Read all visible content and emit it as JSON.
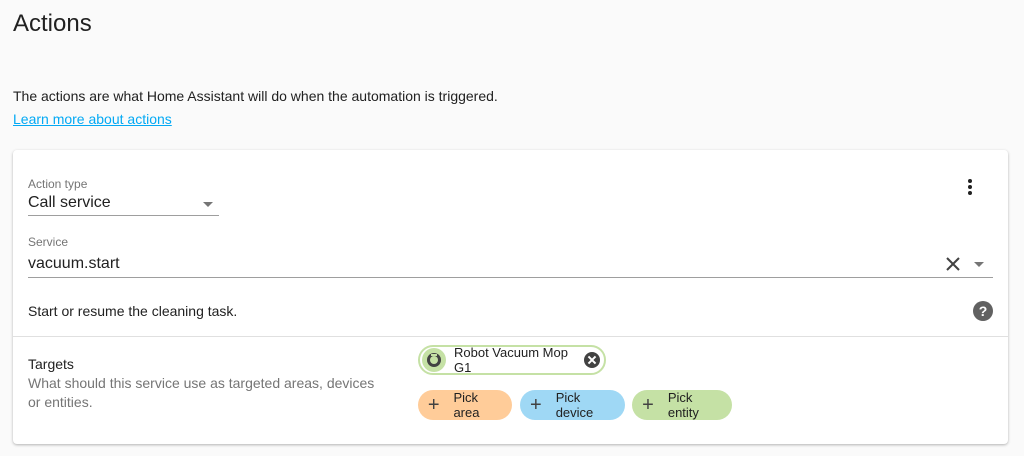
{
  "page": {
    "title": "Actions",
    "intro": "The actions are what Home Assistant will do when the automation is triggered.",
    "learn_more": "Learn more about actions"
  },
  "action": {
    "type_label": "Action type",
    "type_value": "Call service",
    "service_label": "Service",
    "service_value": "vacuum.start",
    "description": "Start or resume the cleaning task.",
    "menu_icon": "dots-vertical-icon",
    "clear_icon": "close-icon",
    "help_icon": "help-circle-icon",
    "help_glyph": "?"
  },
  "targets": {
    "title": "Targets",
    "description": "What should this service use as targeted areas, devices or entities.",
    "selected": [
      {
        "label": "Robot Vacuum Mop G1",
        "icon": "robot-vacuum-icon",
        "color": "#c5e1a5"
      }
    ],
    "pickers": [
      {
        "label": "Pick area",
        "icon": "plus-icon",
        "color": "#ffcc99"
      },
      {
        "label": "Pick device",
        "icon": "plus-icon",
        "color": "#9fd8f5"
      },
      {
        "label": "Pick entity",
        "icon": "plus-icon",
        "color": "#c5e1a5"
      }
    ],
    "plus_glyph": "+"
  },
  "colors": {
    "link": "#03a9f4",
    "background": "#fafafa",
    "card": "#ffffff"
  }
}
